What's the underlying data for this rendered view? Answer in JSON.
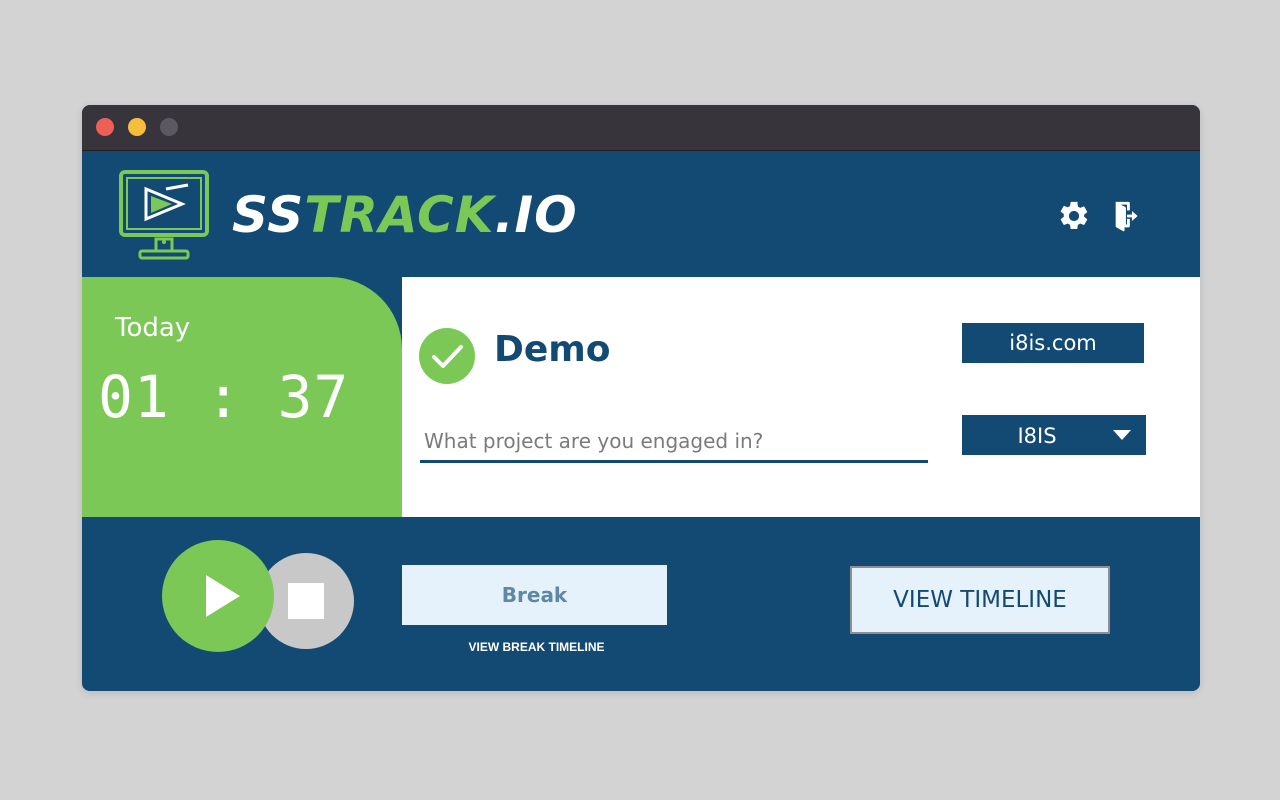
{
  "brand": {
    "name_white": "SS",
    "name_green": "TRACK",
    "name_suffix": ".IO",
    "colors": {
      "navy": "#134a73",
      "green": "#7bc856",
      "white": "#ffffff"
    }
  },
  "header": {
    "icons": [
      "gear-icon",
      "logout-icon"
    ]
  },
  "timer": {
    "label": "Today",
    "value": "01 : 37"
  },
  "user": {
    "name": "Demo",
    "status_icon": "check-circle-icon"
  },
  "project": {
    "placeholder": "What project are you engaged in?",
    "value": ""
  },
  "company": {
    "domain": "i8is.com",
    "selected": "I8IS"
  },
  "controls": {
    "play_icon": "play-icon",
    "stop_icon": "stop-icon",
    "break_label": "Break",
    "break_timeline_label": "VIEW BREAK TIMELINE",
    "timeline_label": "VIEW TIMELINE"
  }
}
